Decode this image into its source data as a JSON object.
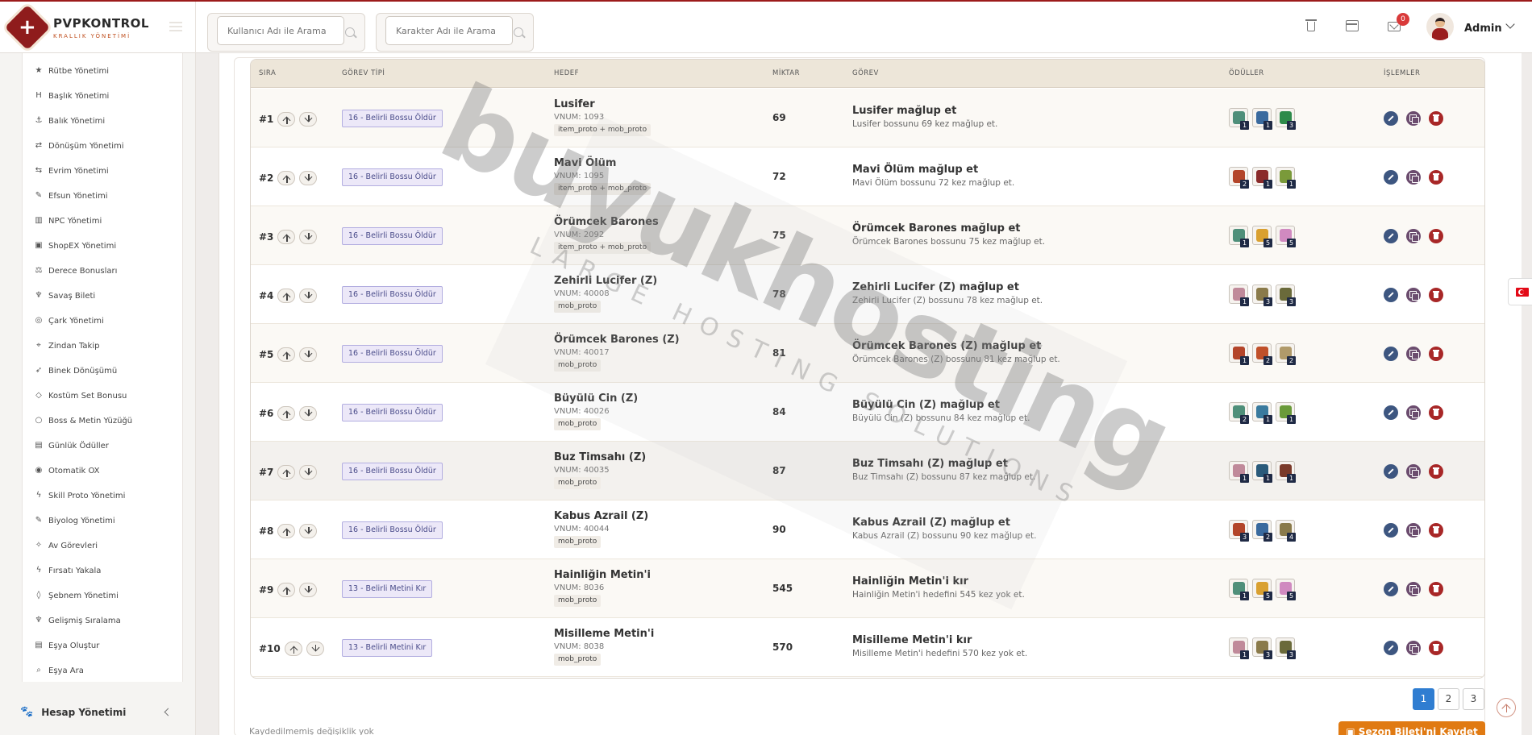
{
  "brand": {
    "title": "PVPKONTROL",
    "subtitle": "KRALLIK YÖNETİMİ"
  },
  "search": {
    "user_placeholder": "Kullanıcı Adı ile Arama",
    "char_placeholder": "Karakter Adı ile Arama"
  },
  "header": {
    "notif_count": "0",
    "user_name": "Admin"
  },
  "sidebar": {
    "items": [
      {
        "label": "Rütbe Yönetimi",
        "icon": "★"
      },
      {
        "label": "Başlık Yönetimi",
        "icon": "H"
      },
      {
        "label": "Balık Yönetimi",
        "icon": "⚓"
      },
      {
        "label": "Dönüşüm Yönetimi",
        "icon": "⇄"
      },
      {
        "label": "Evrim Yönetimi",
        "icon": "⇆"
      },
      {
        "label": "Efsun Yönetimi",
        "icon": "✎"
      },
      {
        "label": "NPC Yönetimi",
        "icon": "▥"
      },
      {
        "label": "ShopEX Yönetimi",
        "icon": "▣"
      },
      {
        "label": "Derece Bonusları",
        "icon": "⚖"
      },
      {
        "label": "Savaş Bileti",
        "icon": "♆"
      },
      {
        "label": "Çark Yönetimi",
        "icon": "◎"
      },
      {
        "label": "Zindan Takip",
        "icon": "⌖"
      },
      {
        "label": "Binek Dönüşümü",
        "icon": "➶"
      },
      {
        "label": "Kostüm Set Bonusu",
        "icon": "◇"
      },
      {
        "label": "Boss & Metin Yüzüğü",
        "icon": "○"
      },
      {
        "label": "Günlük Ödüller",
        "icon": "▤"
      },
      {
        "label": "Otomatik OX",
        "icon": "◉"
      },
      {
        "label": "Skill Proto Yönetimi",
        "icon": "ϟ"
      },
      {
        "label": "Biyolog Yönetimi",
        "icon": "✎"
      },
      {
        "label": "Av Görevleri",
        "icon": "✧"
      },
      {
        "label": "Fırsatı Yakala",
        "icon": "ϟ"
      },
      {
        "label": "Şebnem Yönetimi",
        "icon": "◊"
      },
      {
        "label": "Gelişmiş Sıralama",
        "icon": "♆"
      },
      {
        "label": "Eşya Oluştur",
        "icon": "▤"
      },
      {
        "label": "Eşya Ara",
        "icon": "⌕"
      }
    ],
    "account_label": "Hesap Yönetimi"
  },
  "table": {
    "headers": [
      "SIRA",
      "GÖREV TİPİ",
      "HEDEF",
      "MİKTAR",
      "GÖREV",
      "ÖDÜLLER",
      "İŞLEMLER"
    ],
    "rows": [
      {
        "rank": "#1",
        "type": "16 - Belirli Bossu Öldür",
        "target": "Lusifer",
        "vnum": "VNUM: 1093",
        "tag": "item_proto + mob_proto",
        "amount": "69",
        "task": "Lusifer mağlup et",
        "desc": "Lusifer bossunu 69 kez mağlup et.",
        "rewards": [
          {
            "color": "#4f8f7a",
            "q": "1"
          },
          {
            "color": "#3a6a9e",
            "q": "1"
          },
          {
            "color": "#2d8a4a",
            "q": "3"
          }
        ]
      },
      {
        "rank": "#2",
        "type": "16 - Belirli Bossu Öldür",
        "target": "Mavi Ölüm",
        "vnum": "VNUM: 1095",
        "tag": "item_proto + mob_proto",
        "amount": "72",
        "task": "Mavi Ölüm mağlup et",
        "desc": "Mavi Ölüm bossunu 72 kez mağlup et.",
        "rewards": [
          {
            "color": "#b3452a",
            "q": "2"
          },
          {
            "color": "#8a2a2a",
            "q": "1"
          },
          {
            "color": "#7a9a3a",
            "q": "1"
          }
        ]
      },
      {
        "rank": "#3",
        "type": "16 - Belirli Bossu Öldür",
        "target": "Örümcek Barones",
        "vnum": "VNUM: 2092",
        "tag": "item_proto + mob_proto",
        "amount": "75",
        "task": "Örümcek Barones mağlup et",
        "desc": "Örümcek Barones bossunu 75 kez mağlup et.",
        "rewards": [
          {
            "color": "#4f8f7a",
            "q": "1"
          },
          {
            "color": "#d9a030",
            "q": "5"
          },
          {
            "color": "#d08ac0",
            "q": "5"
          }
        ]
      },
      {
        "rank": "#4",
        "type": "16 - Belirli Bossu Öldür",
        "target": "Zehirli Lucifer (Z)",
        "vnum": "VNUM: 40008",
        "tag": "mob_proto",
        "amount": "78",
        "task": "Zehirli Lucifer (Z) mağlup et",
        "desc": "Zehirli Lucifer (Z) bossunu 78 kez mağlup et.",
        "rewards": [
          {
            "color": "#c08a9a",
            "q": "1"
          },
          {
            "color": "#8a7a4a",
            "q": "3"
          },
          {
            "color": "#6a6a3a",
            "q": "3"
          }
        ]
      },
      {
        "rank": "#5",
        "type": "16 - Belirli Bossu Öldür",
        "target": "Örümcek Barones (Z)",
        "vnum": "VNUM: 40017",
        "tag": "mob_proto",
        "amount": "81",
        "task": "Örümcek Barones (Z) mağlup et",
        "desc": "Örümcek Barones (Z) bossunu 81 kez mağlup et.",
        "rewards": [
          {
            "color": "#b3452a",
            "q": "1"
          },
          {
            "color": "#c0502a",
            "q": "2"
          },
          {
            "color": "#b09a6a",
            "q": "2"
          }
        ]
      },
      {
        "rank": "#6",
        "type": "16 - Belirli Bossu Öldür",
        "target": "Büyülü Cin (Z)",
        "vnum": "VNUM: 40026",
        "tag": "mob_proto",
        "amount": "84",
        "task": "Büyülü Cin (Z) mağlup et",
        "desc": "Büyülü Cin (Z) bossunu 84 kez mağlup et.",
        "rewards": [
          {
            "color": "#4f8f7a",
            "q": "2"
          },
          {
            "color": "#3a7a9e",
            "q": "1"
          },
          {
            "color": "#6a9a3a",
            "q": "1"
          }
        ]
      },
      {
        "rank": "#7",
        "type": "16 - Belirli Bossu Öldür",
        "target": "Buz Timsahı (Z)",
        "vnum": "VNUM: 40035",
        "tag": "mob_proto",
        "amount": "87",
        "task": "Buz Timsahı (Z) mağlup et",
        "desc": "Buz Timsahı (Z) bossunu 87 kez mağlup et.",
        "rewards": [
          {
            "color": "#c08a9a",
            "q": "1"
          },
          {
            "color": "#2a5a7a",
            "q": "1"
          },
          {
            "color": "#7a3a2a",
            "q": "1"
          }
        ]
      },
      {
        "rank": "#8",
        "type": "16 - Belirli Bossu Öldür",
        "target": "Kabus Azrail (Z)",
        "vnum": "VNUM: 40044",
        "tag": "mob_proto",
        "amount": "90",
        "task": "Kabus Azrail (Z) mağlup et",
        "desc": "Kabus Azrail (Z) bossunu 90 kez mağlup et.",
        "rewards": [
          {
            "color": "#b3452a",
            "q": "3"
          },
          {
            "color": "#3a6a9e",
            "q": "2"
          },
          {
            "color": "#8a7a4a",
            "q": "4"
          }
        ]
      },
      {
        "rank": "#9",
        "type": "13 - Belirli Metini Kır",
        "target": "Hainliğin Metin'i",
        "vnum": "VNUM: 8036",
        "tag": "mob_proto",
        "amount": "545",
        "task": "Hainliğin Metin'i kır",
        "desc": "Hainliğin Metin'i hedefini 545 kez yok et.",
        "rewards": [
          {
            "color": "#4f8f7a",
            "q": "1"
          },
          {
            "color": "#d9a030",
            "q": "5"
          },
          {
            "color": "#d08ac0",
            "q": "5"
          }
        ]
      },
      {
        "rank": "#10",
        "type": "13 - Belirli Metini Kır",
        "target": "Misilleme Metin'i",
        "vnum": "VNUM: 8038",
        "tag": "mob_proto",
        "amount": "570",
        "task": "Misilleme Metin'i kır",
        "desc": "Misilleme Metin'i hedefini 570 kez yok et.",
        "rewards": [
          {
            "color": "#c08a9a",
            "q": "1"
          },
          {
            "color": "#8a7a4a",
            "q": "3"
          },
          {
            "color": "#6a6a3a",
            "q": "3"
          }
        ]
      }
    ]
  },
  "pagination": {
    "pages": [
      "1",
      "2",
      "3"
    ],
    "active": "1"
  },
  "footer": {
    "status": "Kaydedilmemiş değişiklik yok",
    "save_label": "Sezon Bileti'ni Kaydet"
  },
  "watermark": {
    "main": "buyukhosting",
    "sub": "LARGE HOSTING SOLUTIONS"
  }
}
